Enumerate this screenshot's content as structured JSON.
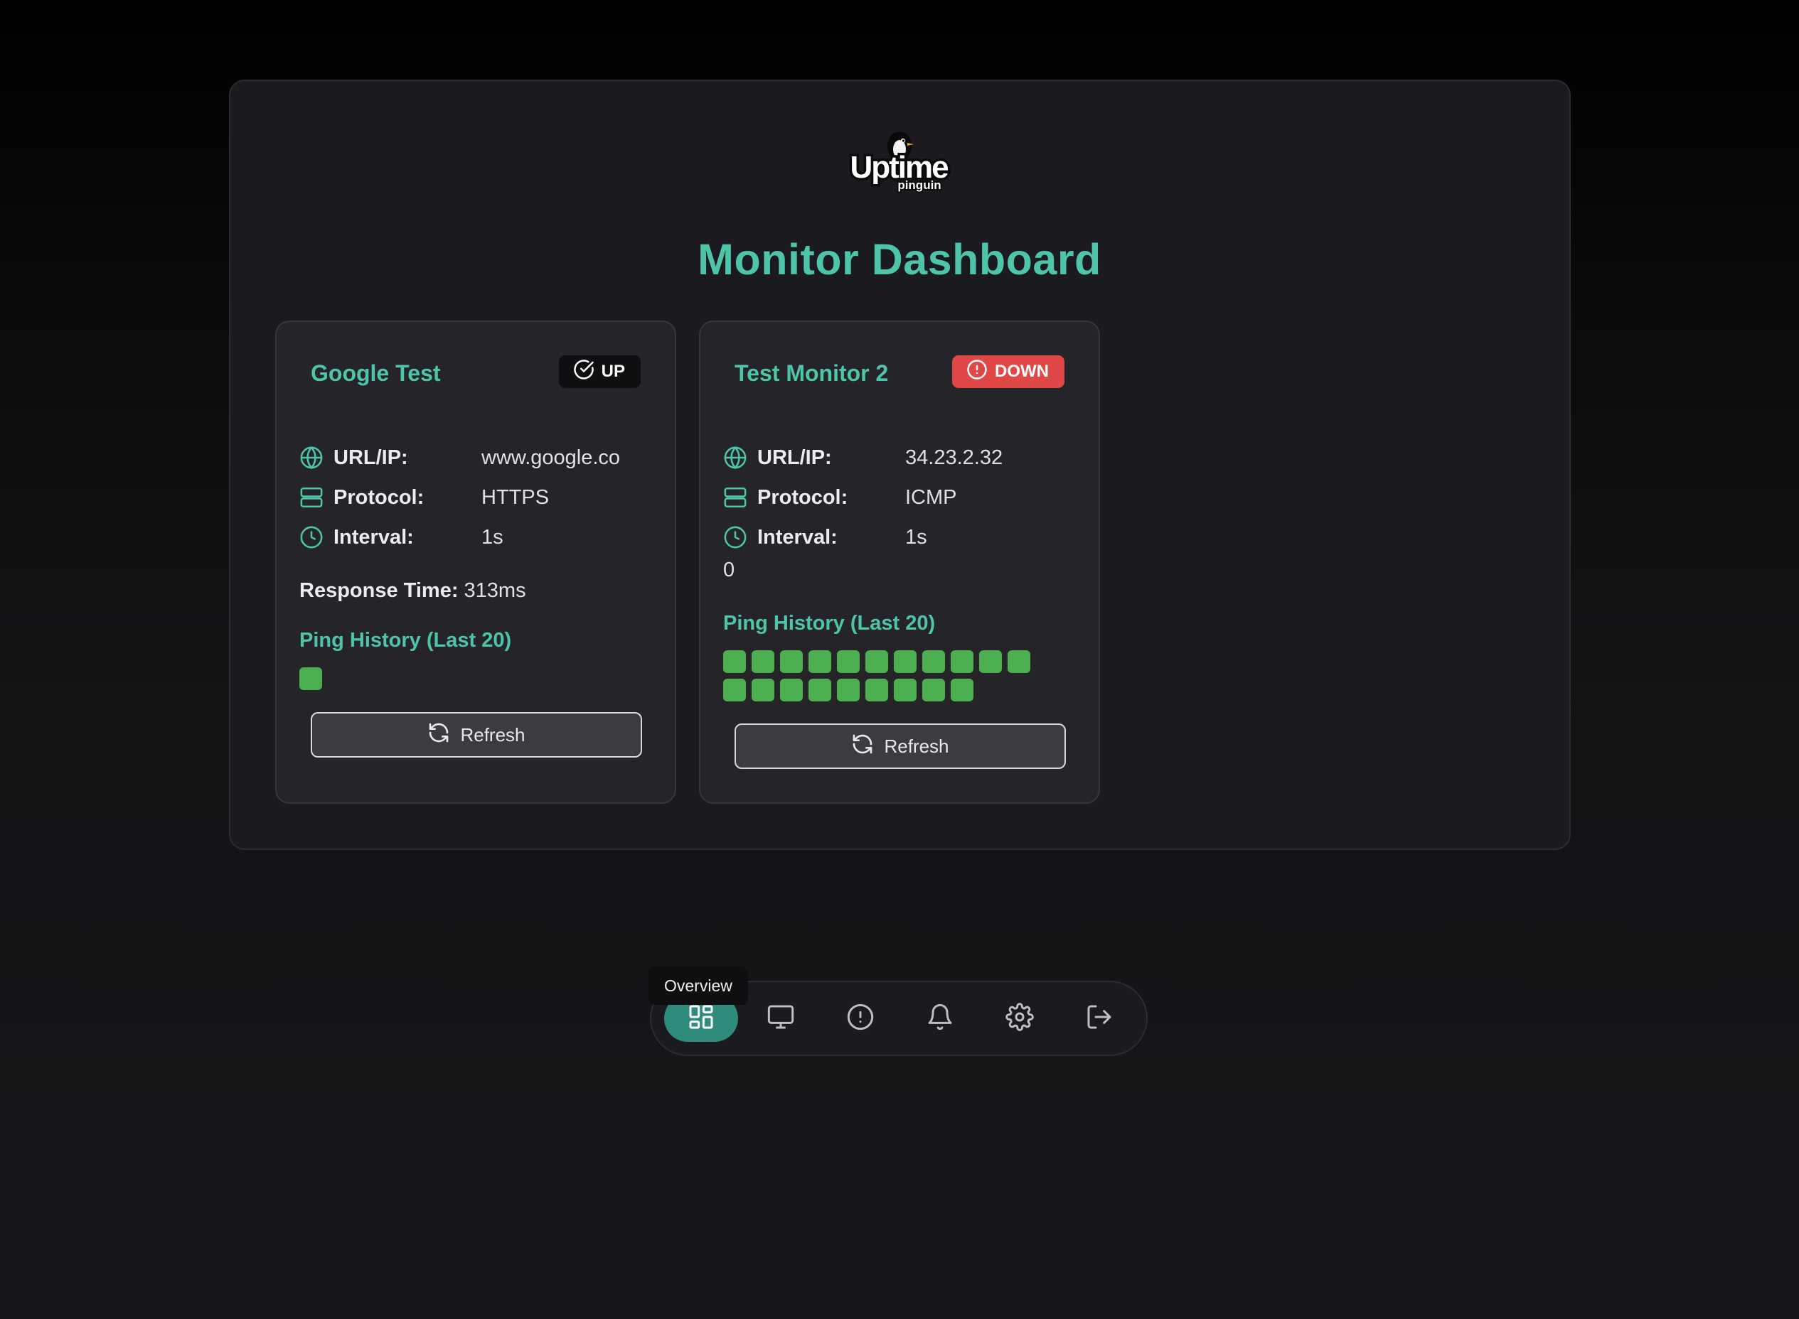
{
  "app": {
    "logo_text": "Uptime",
    "logo_subtext": "pinguin",
    "title": "Monitor Dashboard"
  },
  "colors": {
    "accent": "#4ec5a8",
    "up_badge": "#0f0f11",
    "down_badge": "#e04848",
    "ping_ok": "#4caf50",
    "nav_active": "#2f8c7c"
  },
  "labels": {
    "url": "URL/IP:",
    "protocol": "Protocol:",
    "interval": "Interval:",
    "response_time": "Response Time:",
    "ping_history": "Ping History (Last 20)",
    "refresh": "Refresh"
  },
  "monitors": [
    {
      "name": "Google Test",
      "status": "UP",
      "status_icon": "check-circle-icon",
      "url": "www.google.co",
      "protocol": "HTTPS",
      "interval": "1s",
      "response_time": "313ms",
      "pings": [
        "ok"
      ]
    },
    {
      "name": "Test Monitor 2",
      "status": "DOWN",
      "status_icon": "alert-circle-icon",
      "url": "34.23.2.32",
      "protocol": "ICMP",
      "interval": "1s",
      "extra_value": "0",
      "pings": [
        "ok",
        "ok",
        "ok",
        "ok",
        "ok",
        "ok",
        "ok",
        "ok",
        "ok",
        "ok",
        "ok",
        "ok",
        "ok",
        "ok",
        "ok",
        "ok",
        "ok",
        "ok",
        "ok",
        "ok"
      ]
    }
  ],
  "nav": {
    "tooltip": "Overview",
    "items": [
      {
        "name": "Overview",
        "icon": "grid-icon",
        "active": true
      },
      {
        "name": "Monitors",
        "icon": "monitor-icon",
        "active": false
      },
      {
        "name": "Incidents",
        "icon": "alert-circle-icon",
        "active": false
      },
      {
        "name": "Notifications",
        "icon": "bell-icon",
        "active": false
      },
      {
        "name": "Settings",
        "icon": "gear-icon",
        "active": false
      },
      {
        "name": "Logout",
        "icon": "logout-icon",
        "active": false
      }
    ]
  }
}
